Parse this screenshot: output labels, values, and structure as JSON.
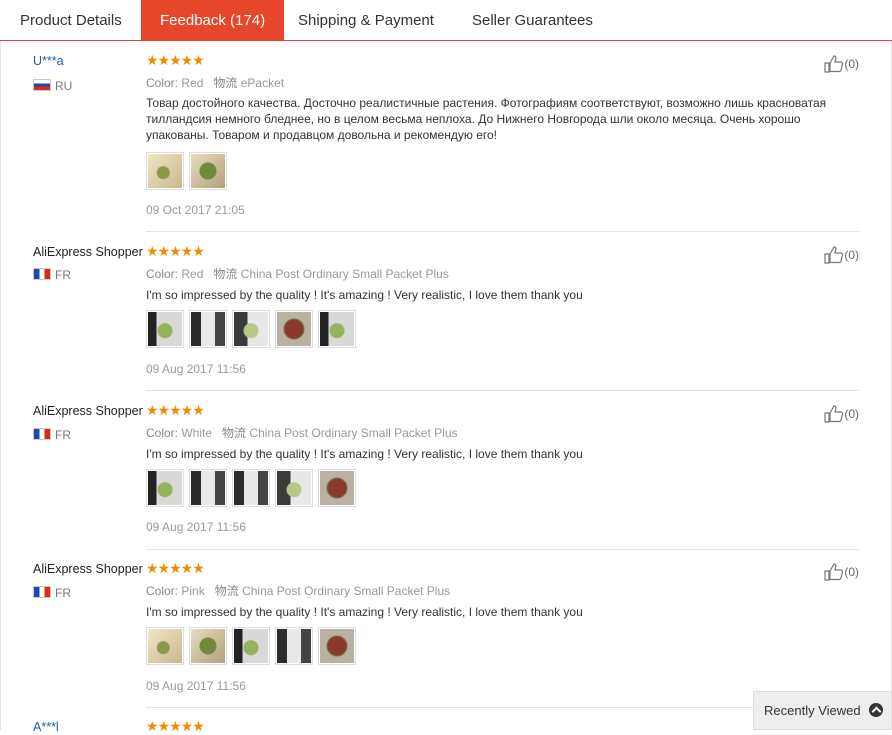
{
  "tabs": [
    {
      "label": "Product Details"
    },
    {
      "label": "Feedback (174)"
    },
    {
      "label": "Shipping & Payment"
    },
    {
      "label": "Seller Guarantees"
    }
  ],
  "colors": {
    "accent": "#e8462b",
    "star": "#f08c00",
    "link": "#1b5fa8"
  },
  "color_label": "Color:",
  "shipping_label": "物流",
  "stars_glyph": "★★★★★",
  "reviews": [
    {
      "name": "U***a",
      "country": "RU",
      "color": "Red",
      "shipping": "ePacket",
      "text": "Товар достойного качества. Досточно реалистичные растения. Фотографиям соответствуют, возможно лишь красноватая тилландсия немного бледнее, но в целом весьма неплоха. До Нижнего Новгорода шли около месяца. Очень хорошо упакованы. Товаром и продавцом довольна и рекомендую его!",
      "date": "09 Oct 2017 21:05",
      "helpful": "(0)",
      "photos": 2
    },
    {
      "name": "AliExpress Shopper",
      "country": "FR",
      "color": "Red",
      "shipping": "China Post Ordinary Small Packet Plus",
      "text": "I'm so impressed by the quality ! It's amazing ! Very realistic, I love them thank you",
      "date": "09 Aug 2017 11:56",
      "helpful": "(0)",
      "photos": 5
    },
    {
      "name": "AliExpress Shopper",
      "country": "FR",
      "color": "White",
      "shipping": "China Post Ordinary Small Packet Plus",
      "text": "I'm so impressed by the quality ! It's amazing ! Very realistic, I love them thank you",
      "date": "09 Aug 2017 11:56",
      "helpful": "(0)",
      "photos": 5
    },
    {
      "name": "AliExpress Shopper",
      "country": "FR",
      "color": "Pink",
      "shipping": "China Post Ordinary Small Packet Plus",
      "text": "I'm so impressed by the quality ! It's amazing ! Very realistic, I love them thank you",
      "date": "09 Aug 2017 11:56",
      "helpful": "(0)",
      "photos": 5
    },
    {
      "name": "A***l"
    }
  ],
  "recently_viewed": "Recently Viewed"
}
